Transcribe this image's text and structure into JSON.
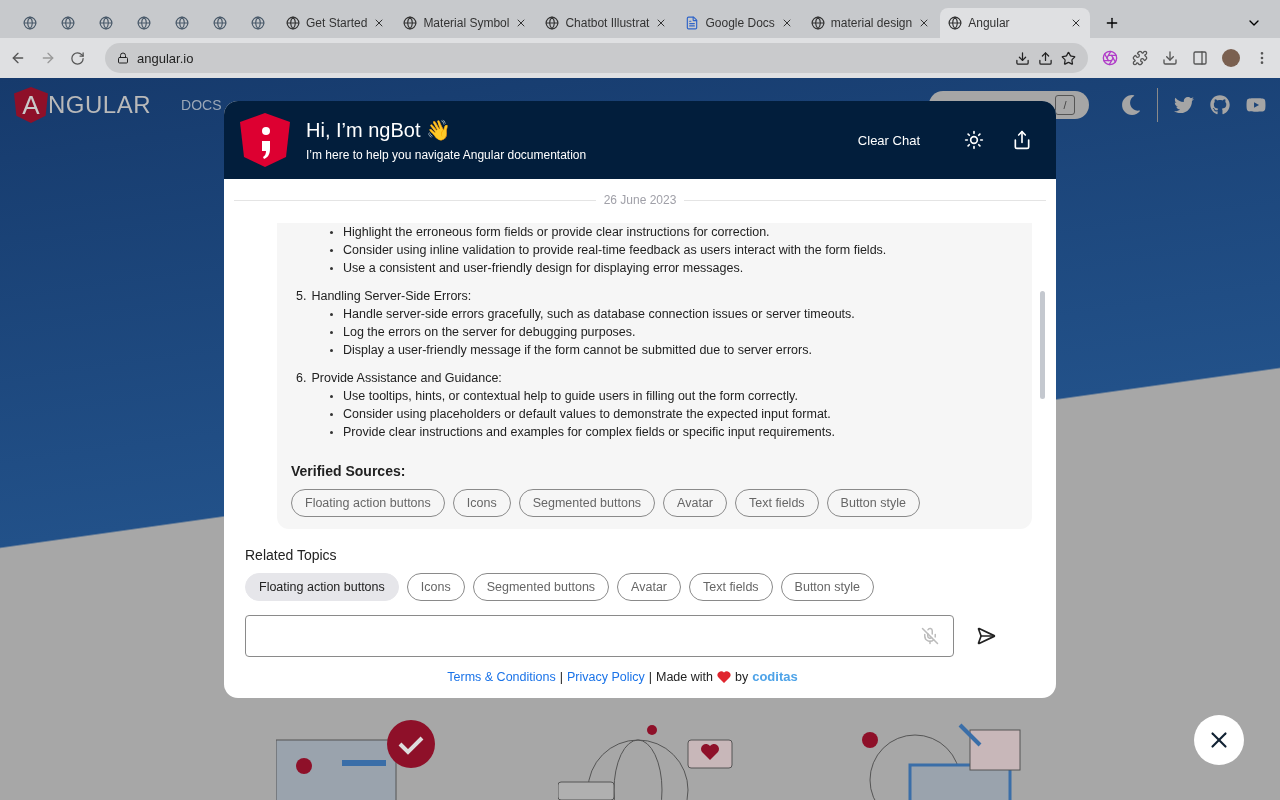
{
  "browser": {
    "tabs": [
      {
        "kind": "icon",
        "selected": false
      },
      {
        "kind": "icon",
        "selected": false
      },
      {
        "kind": "icon",
        "selected": false
      },
      {
        "kind": "icon",
        "selected": false
      },
      {
        "kind": "icon",
        "selected": false
      },
      {
        "kind": "icon",
        "selected": false
      },
      {
        "kind": "icon",
        "selected": false
      },
      {
        "kind": "titled",
        "title": "Get Started",
        "selected": false
      },
      {
        "kind": "titled",
        "title": "Material Symbol",
        "selected": false
      },
      {
        "kind": "titled",
        "title": "Chatbot Illustrat",
        "selected": false
      },
      {
        "kind": "titled",
        "title": "Google Docs",
        "selected": false
      },
      {
        "kind": "titled",
        "title": "material design",
        "selected": false
      },
      {
        "kind": "titled",
        "title": "Angular",
        "selected": true
      }
    ],
    "address": "angular.io"
  },
  "site": {
    "logo_letter": "A",
    "logo_text": "NGULAR",
    "nav": [
      "DOCS"
    ],
    "search_key": "/"
  },
  "chat": {
    "title": "Hi, I’m ngBot 👋",
    "subtitle": "I’m here to help you navigate Angular documentation",
    "clear_label": "Clear Chat",
    "date": "26 June 2023",
    "message": {
      "lead_bullets": [
        "Highlight the erroneous form fields or provide clear instructions for correction.",
        "Consider using inline validation to provide real-time feedback as users interact with the form fields.",
        "Use a consistent and user-friendly design for displaying error messages."
      ],
      "sections": [
        {
          "number": "5.",
          "title": "Handling Server-Side Errors:",
          "bullets": [
            "Handle server-side errors gracefully, such as database connection issues or server timeouts.",
            "Log the errors on the server for debugging purposes.",
            "Display a user-friendly message if the form cannot be submitted due to server errors."
          ]
        },
        {
          "number": "6.",
          "title": "Provide Assistance and Guidance:",
          "bullets": [
            "Use tooltips, hints, or contextual help to guide users in filling out the form correctly.",
            "Consider using placeholders or default values to demonstrate the expected input format.",
            "Provide clear instructions and examples for complex fields or specific input requirements."
          ]
        }
      ],
      "sources_label": "Verified Sources:",
      "sources": [
        "Floating action buttons",
        "Icons",
        "Segmented buttons",
        "Avatar",
        "Text fields",
        "Button style"
      ]
    },
    "related_label": "Related Topics",
    "related": [
      {
        "label": "Floating action buttons",
        "selected": true
      },
      {
        "label": "Icons",
        "selected": false
      },
      {
        "label": "Segmented buttons",
        "selected": false
      },
      {
        "label": "Avatar",
        "selected": false
      },
      {
        "label": "Text fields",
        "selected": false
      },
      {
        "label": "Button style",
        "selected": false
      }
    ],
    "footer": {
      "terms": "Terms & Conditions",
      "separators": [
        "|",
        "|"
      ],
      "privacy": "Privacy Policy",
      "made_with": "Made with",
      "by": "by",
      "brand": "coditas"
    }
  }
}
